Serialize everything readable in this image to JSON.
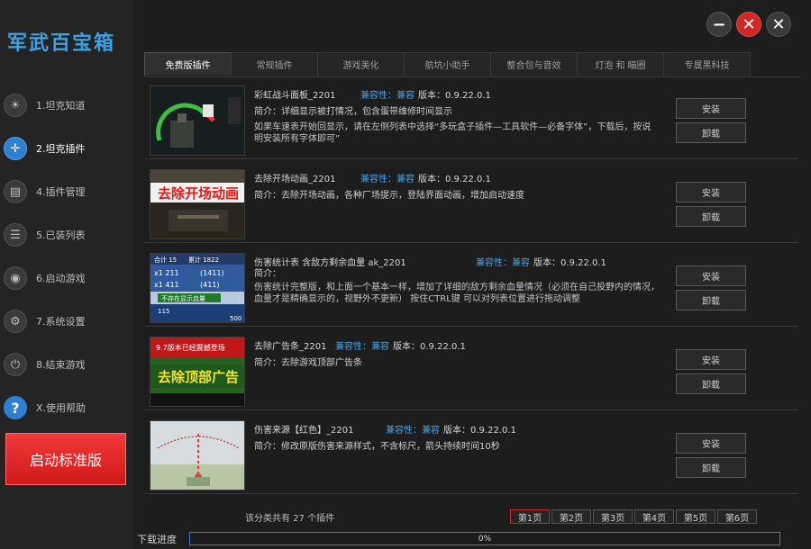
{
  "app": {
    "title": "军武百宝箱"
  },
  "window_controls": {
    "minimize": "−",
    "close_red": "✕",
    "close": "✕"
  },
  "sidebar": {
    "items": [
      {
        "label": "1.坦克知道",
        "icon": "bulb-icon",
        "glyph": "☀"
      },
      {
        "label": "2.坦克插件",
        "icon": "crosshair-icon",
        "glyph": "✛"
      },
      {
        "label": "4.插件管理",
        "icon": "document-icon",
        "glyph": "▤"
      },
      {
        "label": "5.已装列表",
        "icon": "list-icon",
        "glyph": "☰"
      },
      {
        "label": "6.启动游戏",
        "icon": "launch-icon",
        "glyph": "◉"
      },
      {
        "label": "7.系统设置",
        "icon": "gear-icon",
        "glyph": "⚙"
      },
      {
        "label": "8.结束游戏",
        "icon": "power-icon",
        "glyph": "⏻"
      },
      {
        "label": "X.使用帮助",
        "icon": "help-icon",
        "glyph": "?"
      }
    ],
    "launch_button": "启动标准版"
  },
  "tabs": [
    "免费版插件",
    "常规插件",
    "游戏美化",
    "航坑小助手",
    "整合包与音效",
    "灯泡 和 瞄圈",
    "专属黑科技"
  ],
  "plugins": [
    {
      "name": "彩虹战斗面板_2201",
      "compat_label": "兼容性：",
      "compat_value": "兼容",
      "version": "版本：0.9.22.0.1",
      "desc": "简介：详细显示被打情况，包含蛋带维修时间显示",
      "extra": "如果车速表开始回显示，请在左侧列表中选择“多玩盒子插件—工具软件—必备字体”，下载后，按说明安装所有字体即可”",
      "install": "安装",
      "uninstall": "卸载"
    },
    {
      "name": "去除开场动画_2201",
      "compat_label": "兼容性：",
      "compat_value": "兼容",
      "version": "版本：0.9.22.0.1",
      "desc": "简介：去除开场动画，各种厂场提示，登陆界面动画，增加启动速度",
      "extra": "",
      "thumb_text": "去除开场动画",
      "install": "安装",
      "uninstall": "卸载"
    },
    {
      "name": "伤害统计表  含敌方剩余血量  ak_2201",
      "compat_label": "兼容性：",
      "compat_value": "兼容",
      "version": "版本：0.9.22.0.1",
      "desc": "简介：",
      "extra": "伤害统计完整版，和上面一个基本一样，增加了详细的敌方剩余血量情况（必须在自己投野内的情况，血量才是精确显示的，视野外不更新）  按住CTRL键 可以对列表位置进行拖动调整",
      "thumb_labels": [
        "合计 15",
        "累计 1822",
        "x1 211",
        "(1411)",
        "x1 411",
        "(411)",
        "不存在显示血量",
        "115",
        "500"
      ],
      "install": "安装",
      "uninstall": "卸载"
    },
    {
      "name": "去除广告条_2201",
      "compat_label": "兼容性：",
      "compat_value": "兼容",
      "version": "版本：0.9.22.0.1",
      "desc": "简介：去除游戏顶部广告条",
      "extra": "",
      "thumb_top": "9.7版本已经震撼登场",
      "thumb_text": "去除顶部广告",
      "install": "安装",
      "uninstall": "卸载"
    },
    {
      "name": "伤害来源【红色】_2201",
      "compat_label": "兼容性：",
      "compat_value": "兼容",
      "version": "版本：0.9.22.0.1",
      "desc": "简介：修改原版伤害来源样式，不含标尺，箭头持续时间10秒",
      "extra": "",
      "install": "安装",
      "uninstall": "卸载"
    }
  ],
  "footer": {
    "total": "该分类共有 27 个插件",
    "pages": [
      "第1页",
      "第2页",
      "第3页",
      "第4页",
      "第5页",
      "第6页"
    ],
    "active_page": 0,
    "download_label": "下载进度",
    "progress_text": "0%",
    "progress_value": 0
  },
  "colors": {
    "accent": "#2d7fd1",
    "danger": "#d02727",
    "compat": "#4aa3e6"
  }
}
